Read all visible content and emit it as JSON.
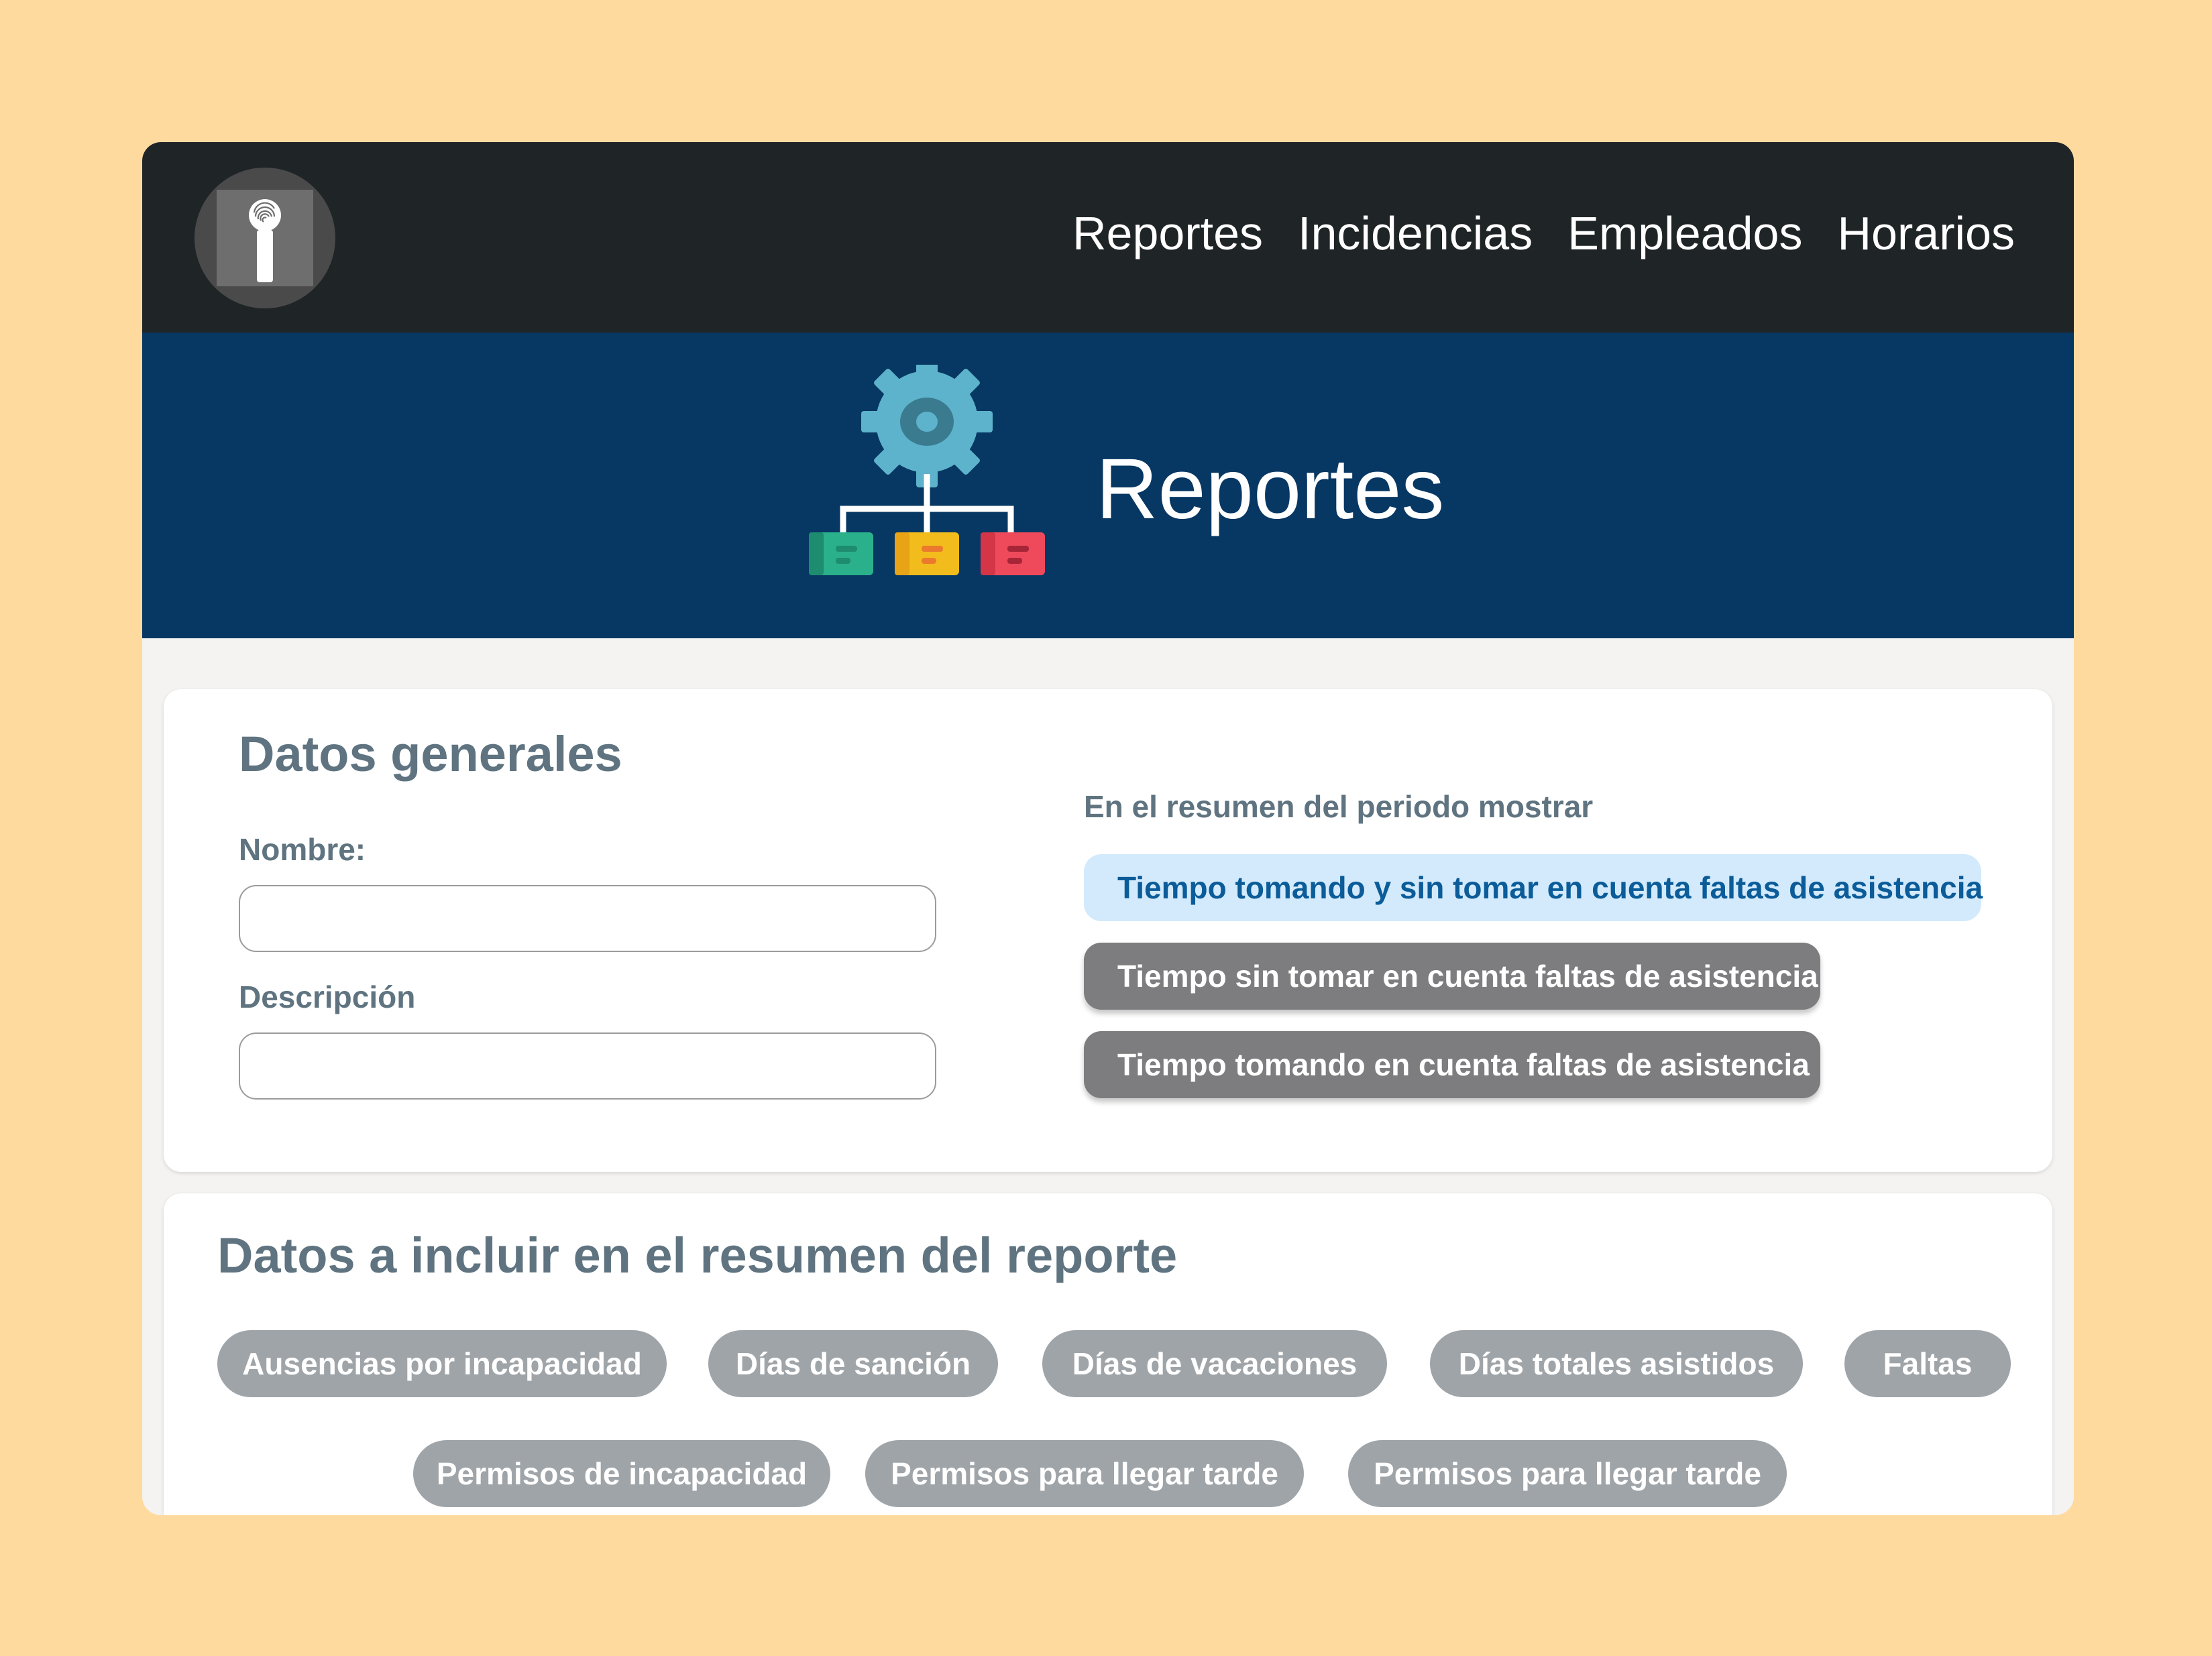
{
  "navbar": {
    "logo_icon": "fingerprint-key-icon",
    "links": [
      "Reportes",
      "Incidencias",
      "Empleados",
      "Horarios"
    ]
  },
  "hero": {
    "icon": "gear-hierarchy-icon",
    "title": "Reportes"
  },
  "general": {
    "title": "Datos generales",
    "name_label": "Nombre:",
    "name_value": "",
    "description_label": "Descripción",
    "description_value": "",
    "summary_label": "En el resumen del periodo mostrar",
    "options": [
      "Tiempo tomando y sin tomar en cuenta faltas de asistencia",
      "Tiempo sin tomar en cuenta faltas de asistencia",
      "Tiempo tomando en cuenta faltas de asistencia"
    ],
    "selected_option_index": 0
  },
  "summary": {
    "title": "Datos a incluir en el  resumen del reporte",
    "chips": [
      "Ausencias por incapacidad",
      "Días de sanción",
      "Días de vacaciones",
      "Días totales asistidos",
      "Faltas",
      "Permisos de incapacidad",
      "Permisos para llegar tarde",
      "Permisos para llegar tarde"
    ]
  },
  "colors": {
    "page_background": "#FFDA9E",
    "navbar": "#1F2427",
    "hero": "#073763",
    "selected_option_bg": "#D2EAFC",
    "selected_option_text": "#0B5C99",
    "option_bg": "#7D7D7F",
    "chip_bg": "#9FA4A8",
    "heading_text": "#5F7480"
  }
}
